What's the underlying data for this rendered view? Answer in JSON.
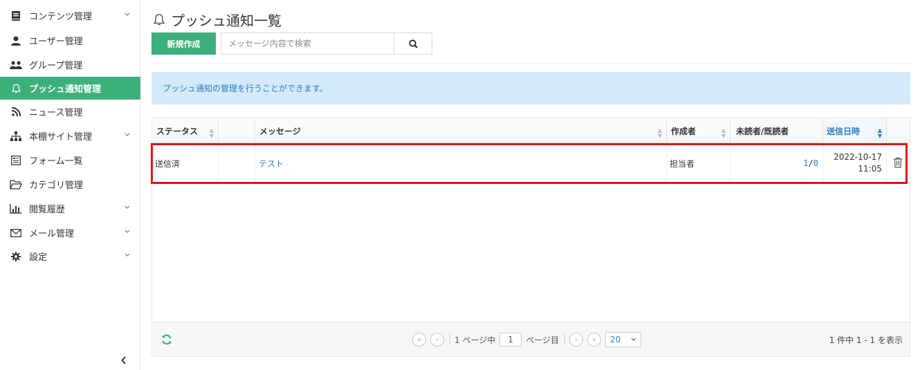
{
  "sidebar": {
    "items": [
      {
        "label": "コンテンツ管理",
        "icon": "book-icon",
        "has_children": true,
        "active": false
      },
      {
        "label": "ユーザー管理",
        "icon": "user-icon",
        "has_children": false,
        "active": false
      },
      {
        "label": "グループ管理",
        "icon": "users-icon",
        "has_children": false,
        "active": false
      },
      {
        "label": "プッシュ通知管理",
        "icon": "bell-icon",
        "has_children": false,
        "active": true
      },
      {
        "label": "ニュース管理",
        "icon": "rss-icon",
        "has_children": false,
        "active": false
      },
      {
        "label": "本棚サイト管理",
        "icon": "sitemap-icon",
        "has_children": true,
        "active": false
      },
      {
        "label": "フォーム一覧",
        "icon": "form-icon",
        "has_children": false,
        "active": false
      },
      {
        "label": "カテゴリ管理",
        "icon": "folder-open-icon",
        "has_children": false,
        "active": false
      },
      {
        "label": "閲覧履歴",
        "icon": "bar-chart-icon",
        "has_children": true,
        "active": false
      },
      {
        "label": "メール管理",
        "icon": "envelope-icon",
        "has_children": true,
        "active": false
      },
      {
        "label": "設定",
        "icon": "gear-icon",
        "has_children": true,
        "active": false
      }
    ]
  },
  "page": {
    "title": "プッシュ通知一覧",
    "new_button": "新規作成",
    "search_placeholder": "メッセージ内容で検索",
    "info_message": "プッシュ通知の管理を行うことができます。"
  },
  "table": {
    "columns": [
      "ステータス",
      "",
      "メッセージ",
      "作成者",
      "未読者/既読者",
      "送信日時",
      ""
    ],
    "sorted_column": "送信日時",
    "rows": [
      {
        "status": "送信済",
        "message": "テスト",
        "author": "担当者",
        "unread": "1",
        "slash": " / ",
        "read": "0",
        "date": "2022-10-17",
        "time": "11:05"
      }
    ]
  },
  "pagination": {
    "current_page": "1",
    "page_prefix": "1 ページ中",
    "page_suffix": "ページ目",
    "per_page": "20",
    "range_text": "1 件中 1 - 1 を表示"
  },
  "colors": {
    "accent": "#3cb07b",
    "link": "#2b7bc0",
    "info_bg": "#d4eafa",
    "highlight": "#e31313"
  }
}
